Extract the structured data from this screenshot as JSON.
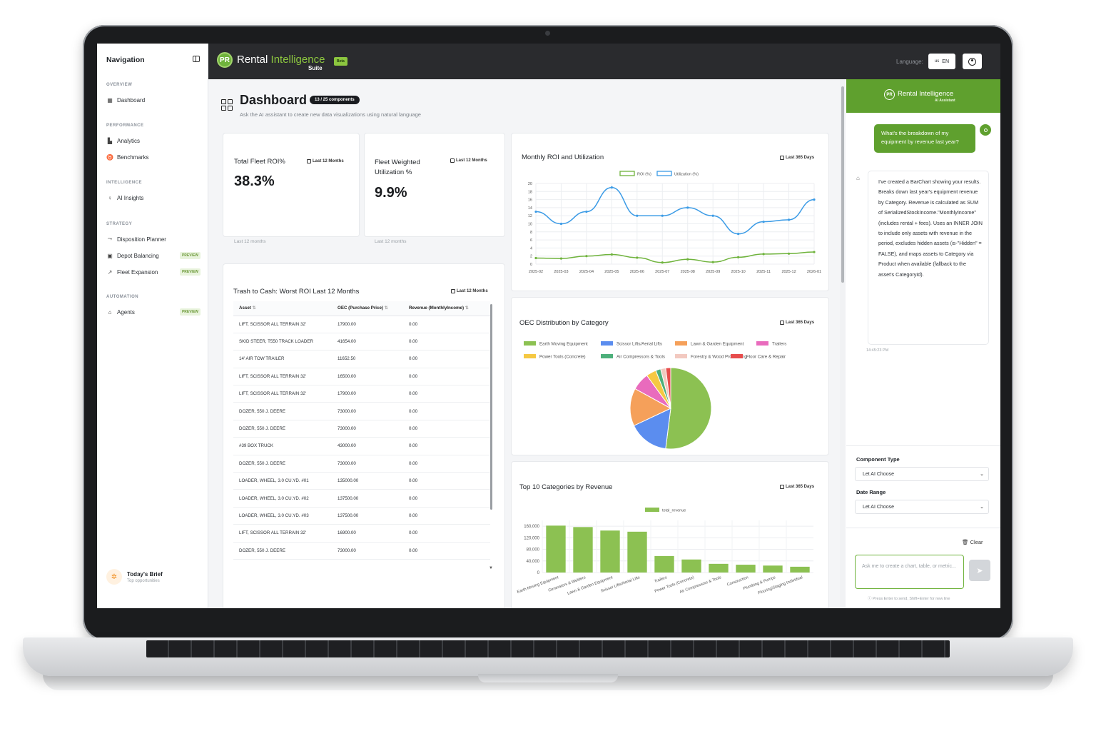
{
  "sidebar": {
    "title": "Navigation",
    "sections": [
      {
        "label": "OVERVIEW",
        "items": [
          {
            "label": "Dashboard",
            "icon": "grid-icon"
          }
        ]
      },
      {
        "label": "PERFORMANCE",
        "items": [
          {
            "label": "Analytics",
            "icon": "bar-chart-icon"
          },
          {
            "label": "Benchmarks",
            "icon": "trophy-icon"
          }
        ]
      },
      {
        "label": "INTELLIGENCE",
        "items": [
          {
            "label": "AI Insights",
            "icon": "lightbulb-icon"
          }
        ]
      },
      {
        "label": "STRATEGY",
        "items": [
          {
            "label": "Disposition Planner",
            "icon": "route-icon"
          },
          {
            "label": "Depot Balancing",
            "icon": "warehouse-icon",
            "badge": "PREVIEW"
          },
          {
            "label": "Fleet Expansion",
            "icon": "trend-up-icon",
            "badge": "PREVIEW"
          }
        ]
      },
      {
        "label": "AUTOMATION",
        "items": [
          {
            "label": "Agents",
            "icon": "robot-icon",
            "badge": "PREVIEW"
          }
        ]
      }
    ],
    "brief": {
      "title": "Today's Brief",
      "subtitle": "Top opportunities"
    }
  },
  "header": {
    "logo_initials": "PR",
    "logo_word1": "Rental ",
    "logo_word2": "Intelligence",
    "logo_suite": "Suite",
    "beta": "Beta",
    "language_label": "Language:",
    "language_flag": "us",
    "language_value": "EN"
  },
  "dashboard": {
    "title": "Dashboard",
    "components_badge": "13 / 25 components",
    "subtitle": "Ask the AI assistant to create new data visualizations using natural language"
  },
  "kpis": [
    {
      "title": "Total Fleet ROI%",
      "period": "Last 12 Months",
      "value": "38.3%",
      "footer": "Last 12 months"
    },
    {
      "title": "Fleet Weighted Utilization %",
      "period": "Last 12 Months",
      "value": "9.9%",
      "footer": "Last 12 months"
    }
  ],
  "trash_table": {
    "title": "Trash to Cash: Worst ROI Last 12 Months",
    "period": "Last 12 Months",
    "columns": [
      "Asset",
      "OEC (Purchase Price)",
      "Revenue (MonthlyIncome)"
    ],
    "rows": [
      [
        "LIFT, SCISSOR ALL TERRAIN 32'",
        "17900.00",
        "0.00"
      ],
      [
        "SKID STEER, T550 TRACK LOADER",
        "41654.00",
        "0.00"
      ],
      [
        "14' AIR TOW TRAILER",
        "11652.50",
        "0.00"
      ],
      [
        "LIFT, SCISSOR ALL TERRAIN 32'",
        "16500.00",
        "0.00"
      ],
      [
        "LIFT, SCISSOR ALL TERRAIN 32'",
        "17900.00",
        "0.00"
      ],
      [
        "DOZER, 550 J. DEERE",
        "73000.00",
        "0.00"
      ],
      [
        "DOZER, 550 J. DEERE",
        "73000.00",
        "0.00"
      ],
      [
        "#39 BOX TRUCK",
        "43000.00",
        "0.00"
      ],
      [
        "DOZER, 550 J. DEERE",
        "73000.00",
        "0.00"
      ],
      [
        "LOADER, WHEEL, 3.0 CU.YD. #01",
        "135000.00",
        "0.00"
      ],
      [
        "LOADER, WHEEL, 3.0 CU.YD. #02",
        "137500.00",
        "0.00"
      ],
      [
        "LOADER, WHEEL, 3.0 CU.YD. #03",
        "137500.00",
        "0.00"
      ],
      [
        "LIFT, SCISSOR ALL TERRAIN 32'",
        "16900.00",
        "0.00"
      ],
      [
        "DOZER, 550 J. DEERE",
        "73000.00",
        "0.00"
      ]
    ]
  },
  "chart_data": [
    {
      "type": "line",
      "title": "Monthly ROI and Utilization",
      "period": "Last 365 Days",
      "x": [
        "2025-02",
        "2025-03",
        "2025-04",
        "2025-05",
        "2025-06",
        "2025-07",
        "2025-08",
        "2025-09",
        "2025-10",
        "2025-11",
        "2025-12",
        "2026-01"
      ],
      "ylim": [
        0,
        20
      ],
      "yticks": [
        0,
        2,
        4,
        6,
        8,
        10,
        12,
        14,
        16,
        18,
        20
      ],
      "series": [
        {
          "name": "ROI (%)",
          "color": "#6fb33c",
          "values": [
            1.5,
            1.4,
            2.0,
            2.4,
            1.6,
            0.4,
            1.2,
            0.5,
            1.7,
            2.5,
            2.6,
            3.0
          ]
        },
        {
          "name": "Utilization (%)",
          "color": "#3b9be6",
          "values": [
            13.0,
            10.0,
            13.0,
            19.0,
            12.0,
            12.0,
            14.0,
            12.0,
            7.5,
            10.5,
            11.0,
            16.0
          ]
        }
      ],
      "legend": "top-center",
      "grid": true
    },
    {
      "type": "pie",
      "title": "OEC Distribution by Category",
      "period": "Last 365 Days",
      "labels": [
        "Earth Moving Equipment",
        "Scissor Lifts/Aerial Lifts",
        "Lawn & Garden Equipment",
        "Trailers",
        "Power Tools (Concrete)",
        "Air Compressors & Tools",
        "Forestry & Wood Processing",
        "Floor Care & Repair"
      ],
      "values": [
        52,
        16,
        15,
        7,
        4,
        2,
        2,
        2
      ],
      "colors": [
        "#8cc152",
        "#5b8def",
        "#f5a05a",
        "#e96bbd",
        "#f5c842",
        "#4caf7a",
        "#f2c9c0",
        "#e74c4c"
      ],
      "legend": "top"
    },
    {
      "type": "bar",
      "title": "Top 10 Categories by Revenue",
      "period": "Last 365 Days",
      "categories": [
        "Earth Moving Equipment",
        "Generators & Welders",
        "Lawn & Garden Equipment",
        "Scissor Lifts/Aerial Lifts",
        "Trailers",
        "Power Tools (Concrete)",
        "Air Compressors & Tools",
        "Construction",
        "Plumbing & Pumps",
        "Flooring/Staging Individual"
      ],
      "series": [
        {
          "name": "total_revenue",
          "color": "#8cc152",
          "values": [
            162000,
            157000,
            145000,
            141000,
            57000,
            45000,
            30000,
            27000,
            24000,
            20000
          ]
        }
      ],
      "ylim": [
        0,
        180000
      ],
      "yticks": [
        0,
        40000,
        80000,
        120000,
        160000
      ],
      "ytick_labels": [
        "0",
        "40,000",
        "80,000",
        "120,000",
        "160,000"
      ],
      "legend": "top-center",
      "grid": true
    }
  ],
  "chat": {
    "brand": "Rental Intelligence",
    "brand_initials": "PR",
    "brand_sub": "AI Assistant",
    "user_message": "What's the breakdown of my equipment by revenue last year?",
    "bot_message": "I've created a BarChart showing your results. Breaks down last year's equipment revenue by Category. Revenue is calculated as SUM of SerializedStockIncome.\"MonthlyIncome\" (includes rental + fees). Uses an INNER JOIN to include only assets with revenue in the period, excludes hidden assets (is-\"Hidden\" = FALSE), and maps assets to Category via Product when available (fallback to the asset's CategoryId).",
    "bot_time": "14:45:23 PM",
    "component_type_label": "Component Type",
    "component_type_value": "Let AI Choose",
    "date_range_label": "Date Range",
    "date_range_value": "Let AI Choose",
    "clear_label": "Clear",
    "input_placeholder": "Ask me to create a chart, table, or metric...",
    "hint": "Press Enter to send, Shift+Enter for new line"
  }
}
